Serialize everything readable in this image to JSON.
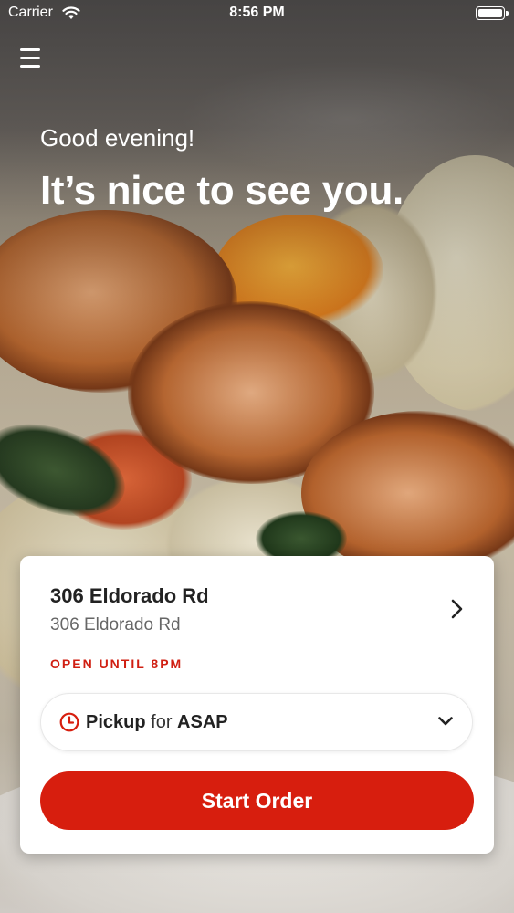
{
  "status_bar": {
    "carrier": "Carrier",
    "time": "8:56 PM",
    "wifi_icon": "wifi-icon",
    "battery_icon": "battery-icon"
  },
  "header": {
    "menu_icon": "hamburger-menu-icon",
    "greeting": "Good evening!",
    "headline": "It’s nice to see you."
  },
  "location_card": {
    "title": "306 Eldorado Rd",
    "address": "306 Eldorado Rd",
    "hours_status": "OPEN UNTIL 8PM",
    "chevron_icon": "chevron-right-icon",
    "pickup": {
      "clock_icon": "clock-icon",
      "mode": "Pickup",
      "connector": "for",
      "time": "ASAP",
      "dropdown_icon": "chevron-down-icon"
    },
    "start_button": "Start Order"
  },
  "colors": {
    "brand_red": "#d71e0e",
    "status_red": "#d01f12",
    "card_bg": "#ffffff"
  }
}
